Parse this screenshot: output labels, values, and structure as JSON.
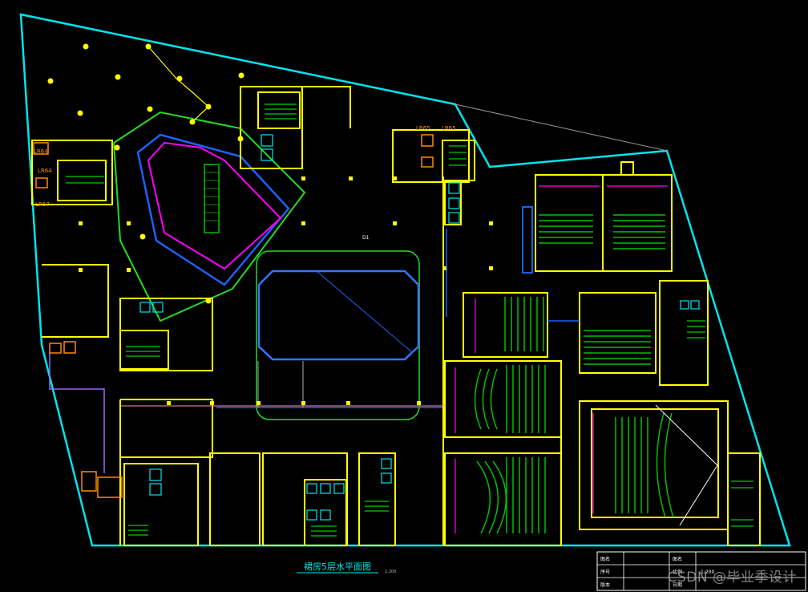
{
  "drawing": {
    "title": "裙房5层水平面图",
    "scale_note": "1:200",
    "room_tags": [
      "LR65",
      "LR65",
      "LR64",
      "LR64",
      "LR67"
    ],
    "small_label": "D1",
    "colors": {
      "boundary": "#00e5ee",
      "wall": "#ffff00",
      "seats": "#00c000",
      "void_blue": "#1e60ff",
      "void_magenta": "#ff00ff",
      "tag": "#ff8c00",
      "stair": "#00ff00"
    }
  },
  "title_block": {
    "rows": [
      [
        "图名",
        "",
        "图名",
        ""
      ],
      [
        "序号",
        "",
        "比例",
        "1:200"
      ],
      [
        "版本",
        "",
        "日期",
        ""
      ]
    ]
  },
  "watermark": "CSDN @毕业季设计"
}
